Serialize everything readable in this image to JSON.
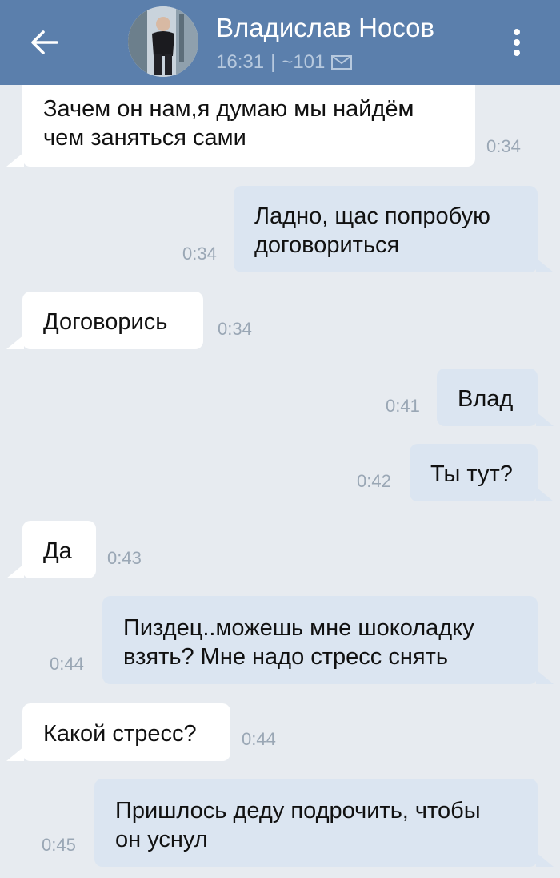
{
  "header": {
    "contact_name": "Владислав Носов",
    "time": "16:31",
    "separator": "|",
    "counter": "~101",
    "colors": {
      "bar": "#5b7fac",
      "title": "#ffffff",
      "subtitle": "#b7c9de"
    },
    "icons": {
      "back": "arrow-left-icon",
      "mail": "envelope-icon",
      "menu": "more-vertical-icon"
    }
  },
  "messages": [
    {
      "direction": "in",
      "text": "Зачем он нам,я думаю мы найдём\nчем заняться сами",
      "time": "0:34"
    },
    {
      "direction": "out",
      "text": "Ладно, щас попробую\nдоговориться",
      "time": "0:34"
    },
    {
      "direction": "in",
      "text": "Договорись",
      "time": "0:34"
    },
    {
      "direction": "out",
      "text": "Влад",
      "time": "0:41"
    },
    {
      "direction": "out",
      "text": "Ты тут?",
      "time": "0:42"
    },
    {
      "direction": "in",
      "text": "Да",
      "time": "0:43"
    },
    {
      "direction": "out",
      "text": "Пиздец..можешь мне шоколадку\nвзять? Мне надо стресс снять",
      "time": "0:44"
    },
    {
      "direction": "in",
      "text": "Какой стресс?",
      "time": "0:44"
    },
    {
      "direction": "out",
      "text": "Пришлось деду подрочить, чтобы\nон уснул",
      "time": "0:45"
    }
  ],
  "colors": {
    "background": "#e7ebf0",
    "incoming": "#ffffff",
    "outgoing": "#dbe5f1",
    "time": "#9aa7b5"
  }
}
